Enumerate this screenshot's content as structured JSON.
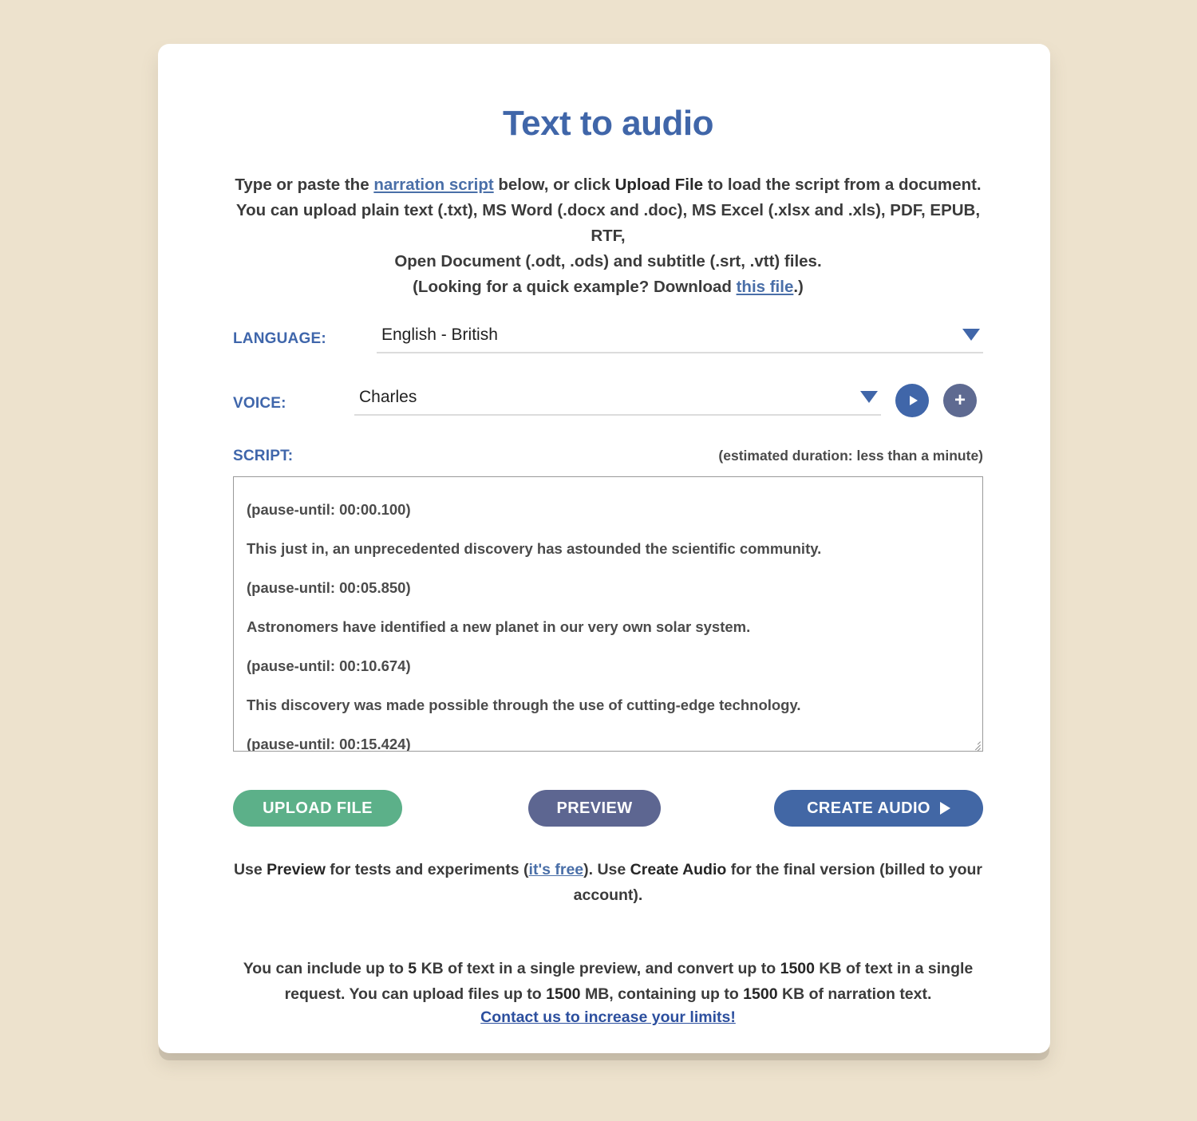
{
  "theme": {
    "page_bg": "#ede2cd",
    "card_bg": "#ffffff",
    "accent_blue": "#4066a9",
    "link_blue": "#4a6fa8",
    "green": "#5cb089",
    "slate": "#5d6691",
    "button_blue": "#4267a5"
  },
  "header": {
    "title": "Text to audio"
  },
  "intro": {
    "line1_a": "Type or paste the ",
    "line1_link": "narration script",
    "line1_b": " below, or click ",
    "line1_strong": "Upload File",
    "line1_c": " to load the script from a document.",
    "line2": "You can upload plain text (.txt), MS Word (.docx and .doc), MS Excel (.xlsx and .xls), PDF, EPUB, RTF,",
    "line3": "Open Document (.odt, .ods) and subtitle (.srt, .vtt) files.",
    "line4_a": "(Looking for a quick example? Download ",
    "line4_link": "this file",
    "line4_b": ".)"
  },
  "form": {
    "language": {
      "label": "LANGUAGE:",
      "value": "English - British",
      "caret_icon": "chevron-down-icon"
    },
    "voice": {
      "label": "VOICE:",
      "value": "Charles",
      "caret_icon": "chevron-down-icon",
      "play_icon": "play-icon",
      "add_icon": "plus-icon"
    },
    "script": {
      "label": "SCRIPT:",
      "duration": "(estimated duration: less than a minute)",
      "lines": [
        "(pause-until: 00:00.100)",
        "This just in, an unprecedented discovery has astounded the scientific community.",
        "(pause-until: 00:05.850)",
        "Astronomers have identified a new planet in our very own solar system.",
        "(pause-until: 00:10.674)",
        "This discovery was made possible through the use of cutting-edge technology.",
        "(pause-until: 00:15.424)"
      ],
      "resize_icon": "resize-handle-icon"
    }
  },
  "actions": {
    "upload": "UPLOAD FILE",
    "preview": "PREVIEW",
    "create": "CREATE AUDIO",
    "create_icon": "play-icon"
  },
  "notes": {
    "usage_a": "Use ",
    "usage_preview": "Preview",
    "usage_b": " for tests and experiments (",
    "usage_link": "it's free",
    "usage_c": "). Use ",
    "usage_create": "Create Audio",
    "usage_d": " for the final version (billed to your account).",
    "limits_a": "You can include up to ",
    "limits_n1": "5",
    "limits_b": " KB of text in a single preview, and convert up to ",
    "limits_n2": "1500",
    "limits_c": " KB of text in a single request. You can upload files up to ",
    "limits_n3": "1500",
    "limits_d": " MB, containing up to ",
    "limits_n4": "1500",
    "limits_e": " KB of narration text.",
    "contact_link": "Contact us to increase your limits!"
  }
}
